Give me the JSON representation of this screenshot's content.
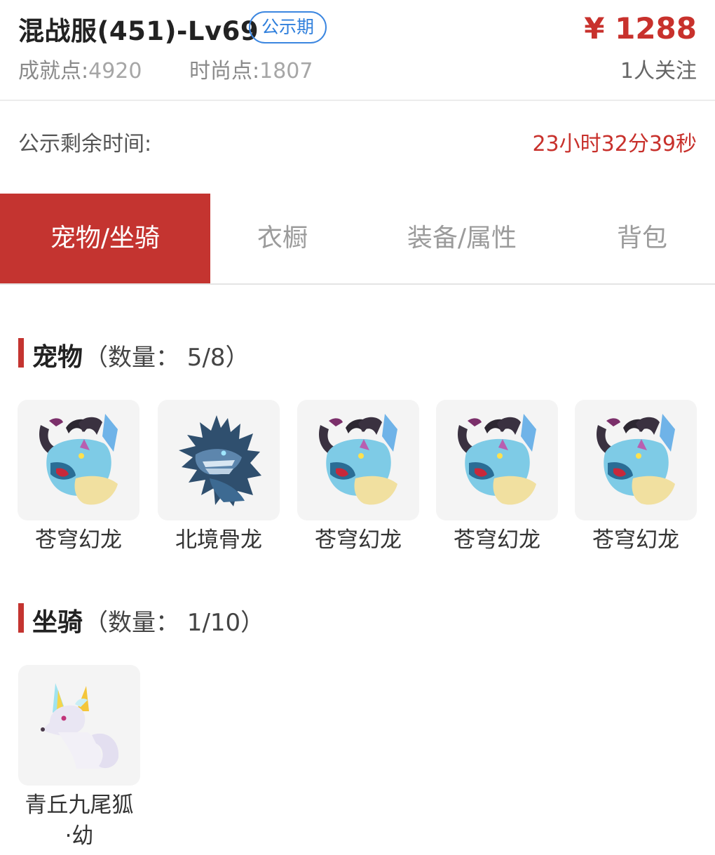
{
  "header": {
    "title": "混战服(451)-Lv69",
    "badge": "公示期",
    "achievement_label": "成就点:",
    "achievement_value": "4920",
    "fashion_label": "时尚点:",
    "fashion_value": "1807",
    "price": "¥ 1288",
    "followers": "1人关注"
  },
  "countdown": {
    "label": "公示剩余时间:",
    "value": "23小时32分39秒"
  },
  "tabs": [
    {
      "label": "宠物/坐骑",
      "active": true
    },
    {
      "label": "衣橱",
      "active": false
    },
    {
      "label": "装备/属性",
      "active": false
    },
    {
      "label": "背包",
      "active": false
    }
  ],
  "pets": {
    "title": "宠物",
    "count": "（数量： 5/8）",
    "items": [
      {
        "name": "苍穹幻龙",
        "icon": "sky-dragon-icon"
      },
      {
        "name": "北境骨龙",
        "icon": "bone-dragon-icon"
      },
      {
        "name": "苍穹幻龙",
        "icon": "sky-dragon-icon"
      },
      {
        "name": "苍穹幻龙",
        "icon": "sky-dragon-icon"
      },
      {
        "name": "苍穹幻龙",
        "icon": "sky-dragon-icon"
      }
    ]
  },
  "mounts": {
    "title": "坐骑",
    "count": "（数量： 1/10）",
    "items": [
      {
        "name_line1": "青丘九尾狐",
        "name_line2": "·幼",
        "icon": "nine-tailed-fox-icon"
      }
    ]
  },
  "colors": {
    "accent": "#c43430",
    "price": "#c8312c",
    "badge": "#2f7fdc"
  }
}
